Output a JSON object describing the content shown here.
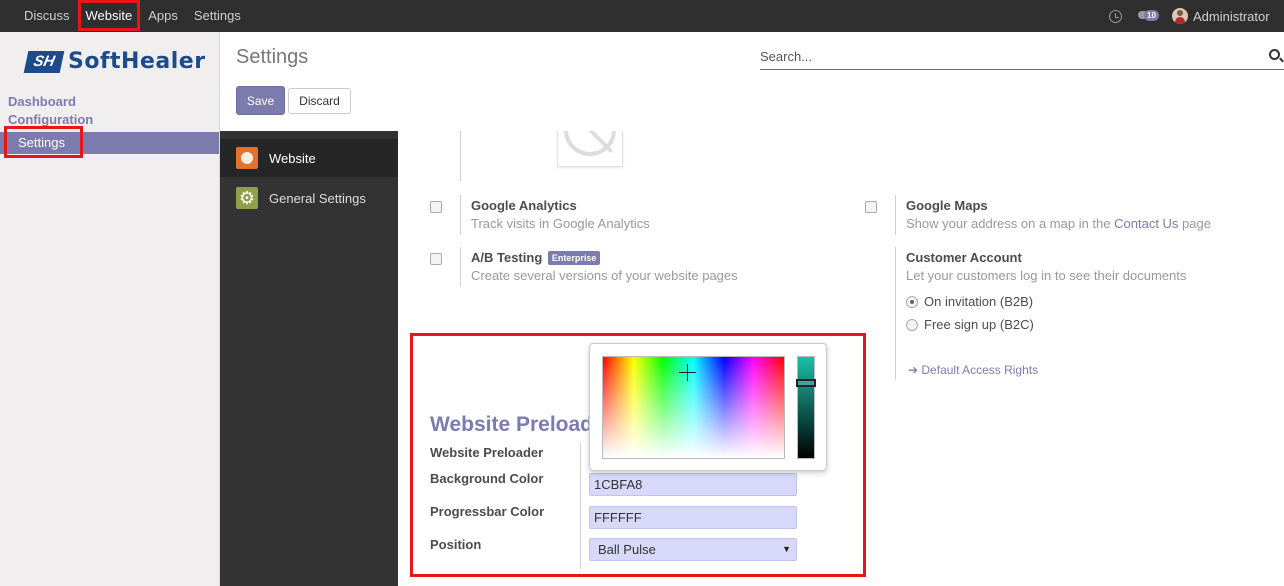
{
  "topbar": {
    "menu": [
      {
        "label": "Discuss"
      },
      {
        "label": "Website"
      },
      {
        "label": "Apps"
      },
      {
        "label": "Settings"
      }
    ],
    "active_menu": "Website",
    "clock_icon": "clock-icon",
    "chat_icon": "chat-icon",
    "message_count": "10",
    "user_name": "Administrator"
  },
  "sidebar": {
    "logo_mark": "SH",
    "logo_text": "SoftHealer",
    "links": [
      "Dashboard",
      "Configuration"
    ],
    "active_item": "Settings"
  },
  "control_panel": {
    "title": "Settings",
    "search_placeholder": "Search...",
    "save_label": "Save",
    "discard_label": "Discard"
  },
  "apps": [
    {
      "label": "Website",
      "icon": "globe-icon"
    },
    {
      "label": "General Settings",
      "icon": "gear-icon"
    }
  ],
  "settings": {
    "google_analytics": {
      "title": "Google Analytics",
      "desc": "Track visits in Google Analytics"
    },
    "google_maps": {
      "title": "Google Maps",
      "desc_prefix": "Show your address on a map in the ",
      "link": "Contact Us",
      "desc_suffix": " page"
    },
    "ab_testing": {
      "title": "A/B Testing",
      "badge": "Enterprise",
      "desc": "Create several versions of your website pages"
    },
    "customer_account": {
      "title": "Customer Account",
      "desc": "Let your customers log in to see their documents",
      "options": [
        "On invitation (B2B)",
        "Free sign up (B2C)"
      ],
      "selected": "On invitation (B2B)",
      "access_link": "Default Access Rights"
    }
  },
  "preloader": {
    "heading": "Website Preloader",
    "fields": {
      "website_preloader": "Website Preloader",
      "background_color": "Background Color",
      "progressbar_color": "Progressbar Color",
      "position": "Position"
    },
    "background_color_value": "1CBFA8",
    "progressbar_color_value": "FFFFFF",
    "position_value": "Ball Pulse",
    "highlight_color": "#e8161b",
    "picker_color": "#1cbfa8"
  },
  "colors": {
    "accent": "#7c7bad",
    "topbar": "#2f2f2f",
    "highlight": "#e8161b"
  }
}
